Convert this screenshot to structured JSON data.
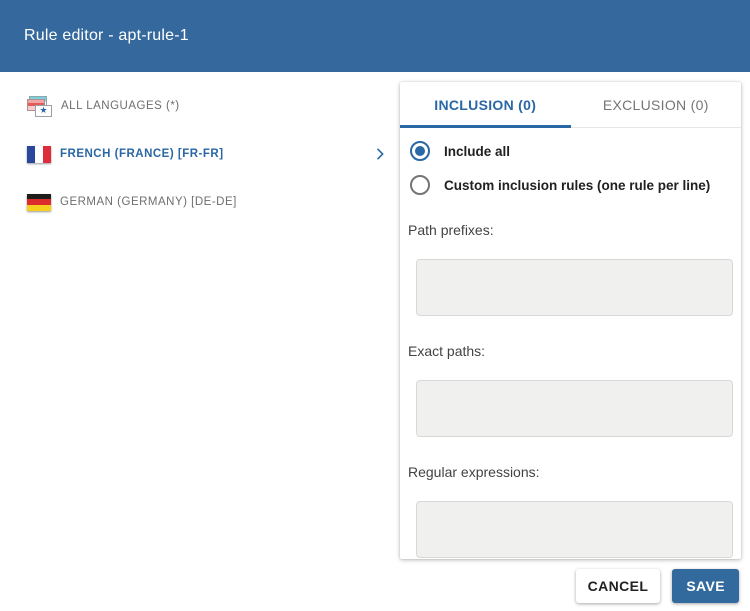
{
  "colors": {
    "header_bg": "#35699E",
    "accent": "#2A67A5",
    "save_bg": "#336A9E",
    "input_bg": "#F0F0EF",
    "muted_text": "#757575",
    "dark_text": "#212121"
  },
  "header": {
    "title": "Rule editor - apt-rule-1"
  },
  "language_list": {
    "items": [
      {
        "label": "ALL LANGUAGES (*)",
        "flag": "all-languages-flag-icon",
        "selected": false
      },
      {
        "label": "FRENCH (FRANCE) [FR-FR]",
        "flag": "france-flag-icon",
        "selected": true
      },
      {
        "label": "GERMAN (GERMANY) [DE-DE]",
        "flag": "germany-flag-icon",
        "selected": false
      }
    ]
  },
  "rules_panel": {
    "tabs": [
      {
        "label": "INCLUSION (0)",
        "active": true
      },
      {
        "label": "EXCLUSION (0)",
        "active": false
      }
    ],
    "mode_options": [
      {
        "label": "Include all",
        "selected": true
      },
      {
        "label": "Custom inclusion rules (one rule per line)",
        "selected": false
      }
    ],
    "fields": [
      {
        "label": "Path prefixes:",
        "value": ""
      },
      {
        "label": "Exact paths:",
        "value": ""
      },
      {
        "label": "Regular expressions:",
        "value": ""
      }
    ]
  },
  "footer": {
    "cancel_label": "CANCEL",
    "save_label": "SAVE"
  },
  "icons": {
    "all_languages_star": "★",
    "chevron_right": "chevron-right-icon"
  }
}
